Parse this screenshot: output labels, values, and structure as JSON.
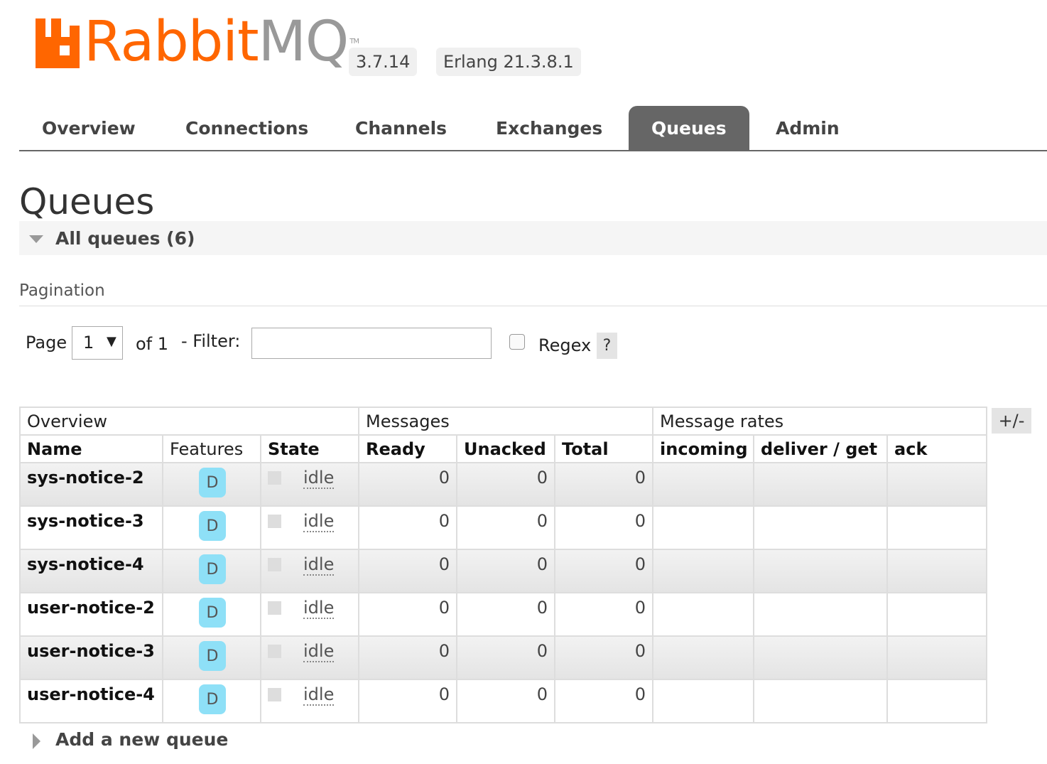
{
  "header": {
    "logo_rabbit": "Rabbit",
    "logo_mq": "MQ",
    "logo_tm": "TM",
    "version": "3.7.14",
    "erlang": "Erlang 21.3.8.1",
    "brand_color": "#ff6600"
  },
  "nav": {
    "items": [
      "Overview",
      "Connections",
      "Channels",
      "Exchanges",
      "Queues",
      "Admin"
    ],
    "active": "Queues"
  },
  "page": {
    "title": "Queues",
    "section": "All queues (6)"
  },
  "pagination": {
    "heading": "Pagination",
    "page_label": "Page",
    "page_value": "1",
    "of_label": "of 1",
    "filter_label": "- Filter:",
    "filter_value": "",
    "regex_label": "Regex",
    "regex_checked": false,
    "help": "?"
  },
  "table": {
    "groups": [
      "Overview",
      "Messages",
      "Message rates"
    ],
    "columns": [
      "Name",
      "Features",
      "State",
      "Ready",
      "Unacked",
      "Total",
      "incoming",
      "deliver / get",
      "ack"
    ],
    "toggle": "+/-",
    "rows": [
      {
        "name": "sys-notice-2",
        "feature": "D",
        "state": "idle",
        "ready": "0",
        "unacked": "0",
        "total": "0",
        "incoming": "",
        "deliver_get": "",
        "ack": ""
      },
      {
        "name": "sys-notice-3",
        "feature": "D",
        "state": "idle",
        "ready": "0",
        "unacked": "0",
        "total": "0",
        "incoming": "",
        "deliver_get": "",
        "ack": ""
      },
      {
        "name": "sys-notice-4",
        "feature": "D",
        "state": "idle",
        "ready": "0",
        "unacked": "0",
        "total": "0",
        "incoming": "",
        "deliver_get": "",
        "ack": ""
      },
      {
        "name": "user-notice-2",
        "feature": "D",
        "state": "idle",
        "ready": "0",
        "unacked": "0",
        "total": "0",
        "incoming": "",
        "deliver_get": "",
        "ack": ""
      },
      {
        "name": "user-notice-3",
        "feature": "D",
        "state": "idle",
        "ready": "0",
        "unacked": "0",
        "total": "0",
        "incoming": "",
        "deliver_get": "",
        "ack": ""
      },
      {
        "name": "user-notice-4",
        "feature": "D",
        "state": "idle",
        "ready": "0",
        "unacked": "0",
        "total": "0",
        "incoming": "",
        "deliver_get": "",
        "ack": ""
      }
    ]
  },
  "footer": {
    "add_queue": "Add a new queue"
  }
}
